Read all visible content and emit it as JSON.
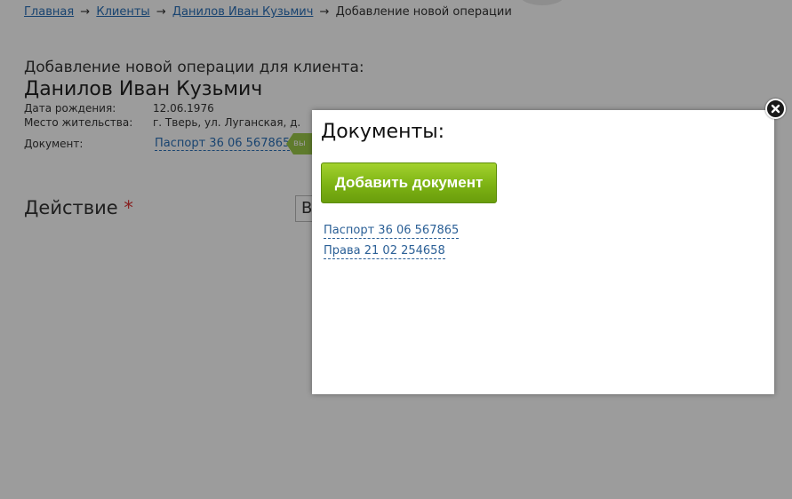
{
  "breadcrumb": {
    "home": "Главная",
    "clients": "Клиенты",
    "client": "Данилов Иван Кузьмич",
    "current": "Добавление новой операции",
    "separator": "→"
  },
  "client_info": {
    "subtitle": "Добавление новой операции для клиента:",
    "name": "Данилов Иван Кузьмич",
    "birth_label": "Дата рождения:",
    "birth_value": "12.06.1976",
    "residence_label": "Место жительства:",
    "residence_value": "г. Тверь, ул. Луганская, д.",
    "document_label": "Документ:",
    "document_value": "Паспорт 36 06 567865",
    "select_button": "вы"
  },
  "action": {
    "label": "Действие",
    "required_mark": "*",
    "select_value": "В"
  },
  "modal": {
    "title": "Документы:",
    "add_button": "Добавить документ",
    "documents": [
      "Паспорт 36 06 567865",
      "Права 21 02 254658"
    ]
  },
  "colors": {
    "link": "#2a6fb8",
    "add_button": "#7db314",
    "overlay": "rgba(0,0,0,0.39)",
    "required": "#d33"
  }
}
